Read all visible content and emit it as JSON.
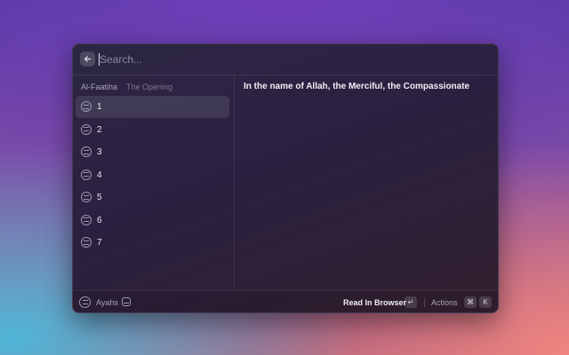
{
  "search": {
    "placeholder": "Search..."
  },
  "list": {
    "section_title": "Al-Faatiha",
    "section_subtitle": "The Opening",
    "items": [
      {
        "label": "1"
      },
      {
        "label": "2"
      },
      {
        "label": "3"
      },
      {
        "label": "4"
      },
      {
        "label": "5"
      },
      {
        "label": "6"
      },
      {
        "label": "7"
      }
    ],
    "selected_index": 0
  },
  "detail": {
    "text": "In the name of Allah, the Merciful, the Compassionate"
  },
  "footer": {
    "title": "Ayahs",
    "primary_action": "Read In Browser",
    "primary_shortcut": "↵",
    "actions_label": "Actions",
    "actions_shortcut_mod": "⌘",
    "actions_shortcut_key": "K"
  }
}
